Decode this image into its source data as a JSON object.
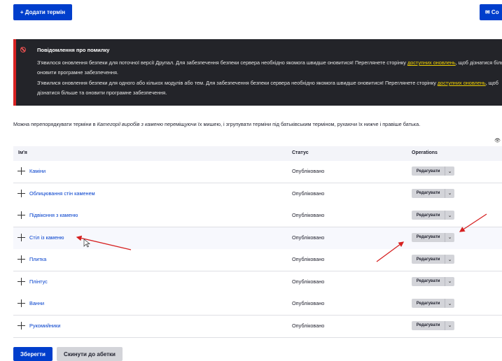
{
  "toolbar": {
    "add_term": "+ Додати термін",
    "top_right": "✉ Co"
  },
  "error": {
    "title": "Повідомлення про помилку",
    "msg1_pre": "З'явилося оновлення безпеки для поточної версії Друпал. Для забезпечення безпеки сервера необхідно якомога швидше оновитися! Переглянете сторінку ",
    "msg1_link": "доступних оновлень",
    "msg1_post": ", щоб дізнатися більше та оновити програмне забезпечення.",
    "msg2_pre": "З'явилися оновлення безпеки для одного або кількох модулів або тем. Для забезпечення безпеки сервера необхідно якомога швидше оновитися! Переглянете сторінку ",
    "msg2_link": "доступних оновлень",
    "msg2_post": ", щоб дізнатися більше та оновити програмне забезпечення."
  },
  "intro": {
    "pre": "Можна перепорядкувати терміни в ",
    "vocab": "Категорії виробів з каменю",
    "post": " переміщуючи їх мишею, і згрупувати терміни під батьківським терміном, рухаючи їх нижче і правіше батька."
  },
  "table": {
    "headers": [
      "Ім'я",
      "Статус",
      "Operations"
    ],
    "rows": [
      {
        "name": "Каміни",
        "status": "Опубліковано",
        "op": "Редагувати"
      },
      {
        "name": "Облицювання стін каменем",
        "status": "Опубліковано",
        "op": "Редагувати"
      },
      {
        "name": "Підвіконня з каменю",
        "status": "Опубліковано",
        "op": "Редагувати"
      },
      {
        "name": "Стіл із каменю",
        "status": "Опубліковано",
        "op": "Редагувати"
      },
      {
        "name": "Плитка",
        "status": "Опубліковано",
        "op": "Редагувати"
      },
      {
        "name": "Плінтус",
        "status": "Опубліковано",
        "op": "Редагувати"
      },
      {
        "name": "Ванни",
        "status": "Опубліковано",
        "op": "Редагувати"
      },
      {
        "name": "Рукомийники",
        "status": "Опубліковано",
        "op": "Редагувати"
      }
    ]
  },
  "footer": {
    "save": "Зберегти",
    "reset": "Скинути до абетки"
  },
  "colors": {
    "primary": "#003ecc",
    "error_bg": "#232429",
    "annotation": "#d62020"
  }
}
